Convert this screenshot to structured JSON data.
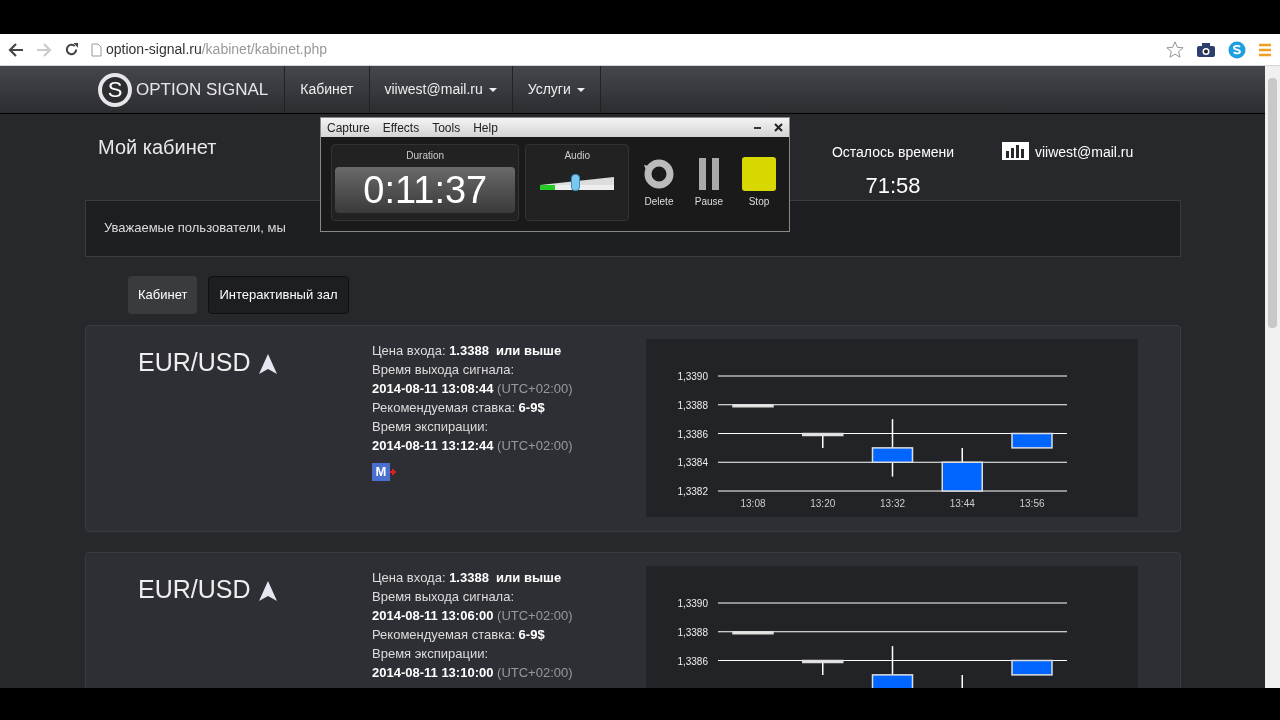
{
  "browser": {
    "url_domain": "option-signal.ru",
    "url_path": "/kabinet/kabinet.php"
  },
  "navbar": {
    "logo_letter": "S",
    "brand": "OPTION SIGNAL",
    "items": [
      {
        "label": "Кабинет",
        "dropdown": false
      },
      {
        "label": "viiwest@mail.ru",
        "dropdown": true
      },
      {
        "label": "Услуги",
        "dropdown": true
      }
    ]
  },
  "page_title": "Мой кабинет",
  "timer": {
    "label": "Осталось времени",
    "value": "71:58"
  },
  "user_email": "viiwest@mail.ru",
  "notice": "Уважаемые пользователи, мы",
  "tabs": [
    {
      "label": "Кабинет",
      "selected": true
    },
    {
      "label": "Интерактивный зал",
      "selected": false
    }
  ],
  "signals": [
    {
      "pair": "EUR/USD",
      "entry_price": {
        "label": "Цена входа:",
        "value": "1.3388  или выше"
      },
      "signal_time": {
        "label": "Время выхода сигнала:",
        "value": "2014-08-11 13:08:44",
        "tz": "(UTC+02:00)"
      },
      "stake": {
        "label": "Рекомендуемая ставка:",
        "value": "6-9$"
      },
      "expiry": {
        "label": "Время экспирации:",
        "value": "2014-08-11 13:12:44",
        "tz": "(UTC+02:00)"
      },
      "share_badge": "M",
      "chart": {
        "y_labels": [
          "1,3390",
          "1,3388",
          "1,3386",
          "1,3384",
          "1,3382"
        ],
        "x_labels": [
          "13:08",
          "13:20",
          "13:32",
          "13:44",
          "13:56"
        ]
      }
    },
    {
      "pair": "EUR/USD",
      "entry_price": {
        "label": "Цена входа:",
        "value": "1.3388  или выше"
      },
      "signal_time": {
        "label": "Время выхода сигнала:",
        "value": "2014-08-11 13:06:00",
        "tz": "(UTC+02:00)"
      },
      "stake": {
        "label": "Рекомендуемая ставка:",
        "value": "6-9$"
      },
      "expiry": {
        "label": "Время экспирации:",
        "value": "2014-08-11 13:10:00",
        "tz": "(UTC+02:00)"
      },
      "chart": {
        "y_labels": [
          "1,3390",
          "1,3388",
          "1,3386"
        ]
      }
    }
  ],
  "recorder": {
    "menu": [
      "Capture",
      "Effects",
      "Tools",
      "Help"
    ],
    "duration_label": "Duration",
    "duration": "0:11:37",
    "audio_label": "Audio",
    "audio_volume": {
      "level": 0.47
    },
    "audio_meter": {
      "level": 0.2
    },
    "buttons": [
      {
        "label": "Delete",
        "kind": "delete"
      },
      {
        "label": "Pause",
        "kind": "pause"
      },
      {
        "label": "Stop",
        "kind": "stop"
      }
    ]
  }
}
